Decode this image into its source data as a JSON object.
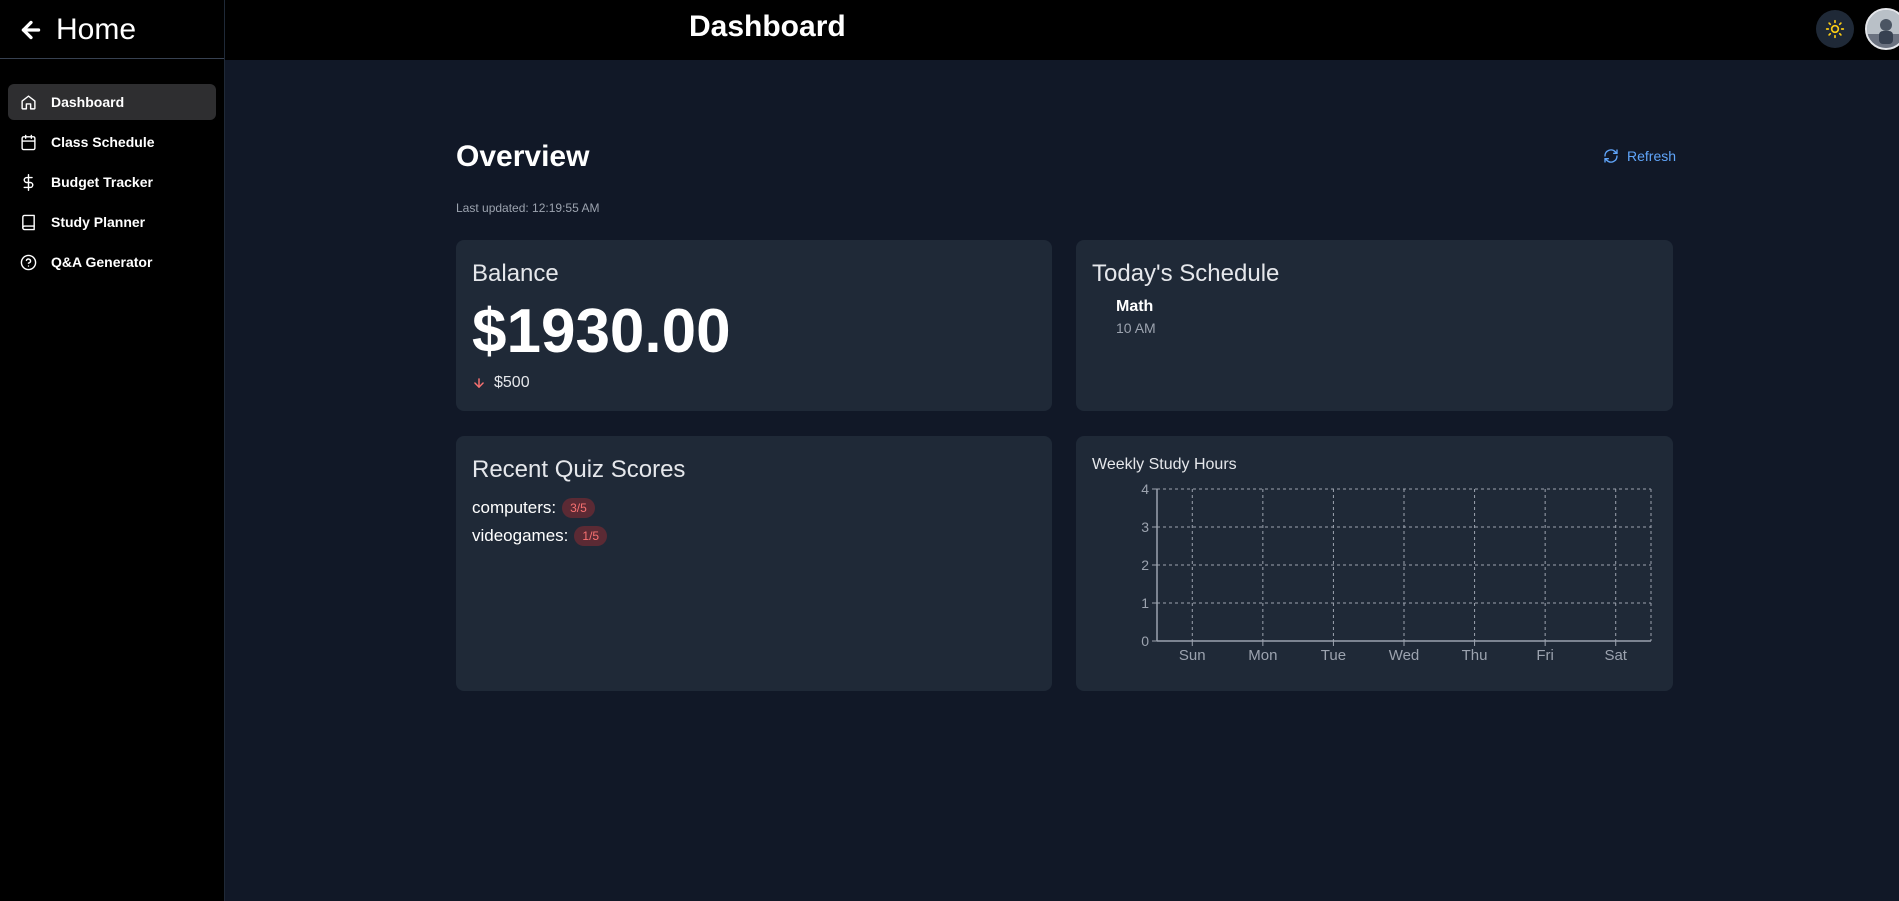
{
  "sidebar": {
    "home_label": "Home",
    "items": [
      {
        "label": "Dashboard",
        "icon": "home-icon",
        "active": true
      },
      {
        "label": "Class Schedule",
        "icon": "calendar-icon",
        "active": false
      },
      {
        "label": "Budget Tracker",
        "icon": "dollar-icon",
        "active": false
      },
      {
        "label": "Study Planner",
        "icon": "book-icon",
        "active": false
      },
      {
        "label": "Q&A Generator",
        "icon": "help-circle-icon",
        "active": false
      }
    ]
  },
  "header": {
    "title": "Dashboard",
    "theme_icon": "sun-icon",
    "avatar_icon": "user-avatar"
  },
  "overview": {
    "title": "Overview",
    "last_updated": "Last updated: 12:19:55 AM",
    "refresh_label": "Refresh"
  },
  "balance": {
    "title": "Balance",
    "amount": "$1930.00",
    "change": "$500",
    "change_direction": "down"
  },
  "schedule": {
    "title": "Today's Schedule",
    "items": [
      {
        "subject": "Math",
        "time": "10 AM"
      }
    ]
  },
  "quiz": {
    "title": "Recent Quiz Scores",
    "items": [
      {
        "topic": "computers:",
        "score": "3/5"
      },
      {
        "topic": "videogames:",
        "score": "1/5"
      }
    ]
  },
  "colors": {
    "background": "#111827",
    "card": "#1f2937",
    "accent": "#60a5fa",
    "negative": "#f87171",
    "sun": "#facc15"
  },
  "chart_data": {
    "type": "line",
    "title": "Weekly Study Hours",
    "categories": [
      "Sun",
      "Mon",
      "Tue",
      "Wed",
      "Thu",
      "Fri",
      "Sat"
    ],
    "series": [],
    "yticks": [
      0,
      1,
      2,
      3,
      4
    ],
    "ylim": [
      0,
      4
    ],
    "grid": true
  }
}
